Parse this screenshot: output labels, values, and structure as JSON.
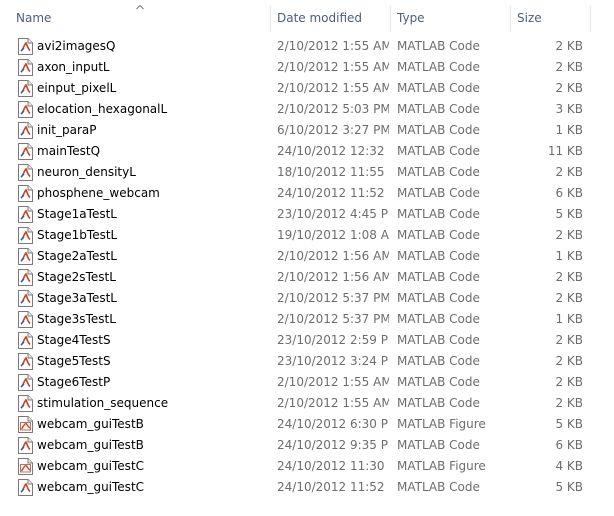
{
  "columns": {
    "name": "Name",
    "date": "Date modified",
    "type": "Type",
    "size": "Size"
  },
  "sort": {
    "column": "Name",
    "direction": "ascending",
    "icon": "sort-up-icon"
  },
  "files": [
    {
      "name": "avi2imagesQ",
      "date": "2/10/2012 1:55 AM",
      "type": "MATLAB Code",
      "size": "2 KB",
      "icon": "matlab-code-file-icon"
    },
    {
      "name": "axon_inputL",
      "date": "2/10/2012 1:55 AM",
      "type": "MATLAB Code",
      "size": "2 KB",
      "icon": "matlab-code-file-icon"
    },
    {
      "name": "einput_pixelL",
      "date": "2/10/2012 1:55 AM",
      "type": "MATLAB Code",
      "size": "2 KB",
      "icon": "matlab-code-file-icon"
    },
    {
      "name": "elocation_hexagonalL",
      "date": "2/10/2012 5:03 PM",
      "type": "MATLAB Code",
      "size": "3 KB",
      "icon": "matlab-code-file-icon"
    },
    {
      "name": "init_paraP",
      "date": "6/10/2012 3:27 PM",
      "type": "MATLAB Code",
      "size": "1 KB",
      "icon": "matlab-code-file-icon"
    },
    {
      "name": "mainTestQ",
      "date": "24/10/2012 12:32 ...",
      "type": "MATLAB Code",
      "size": "11 KB",
      "icon": "matlab-code-file-icon"
    },
    {
      "name": "neuron_densityL",
      "date": "18/10/2012 11:55 ...",
      "type": "MATLAB Code",
      "size": "2 KB",
      "icon": "matlab-code-file-icon"
    },
    {
      "name": "phosphene_webcam",
      "date": "24/10/2012 11:52 ...",
      "type": "MATLAB Code",
      "size": "6 KB",
      "icon": "matlab-code-file-icon"
    },
    {
      "name": "Stage1aTestL",
      "date": "23/10/2012 4:45 PM",
      "type": "MATLAB Code",
      "size": "5 KB",
      "icon": "matlab-code-file-icon"
    },
    {
      "name": "Stage1bTestL",
      "date": "19/10/2012 1:08 AM",
      "type": "MATLAB Code",
      "size": "2 KB",
      "icon": "matlab-code-file-icon"
    },
    {
      "name": "Stage2aTestL",
      "date": "2/10/2012 1:56 AM",
      "type": "MATLAB Code",
      "size": "1 KB",
      "icon": "matlab-code-file-icon"
    },
    {
      "name": "Stage2sTestL",
      "date": "2/10/2012 1:56 AM",
      "type": "MATLAB Code",
      "size": "2 KB",
      "icon": "matlab-code-file-icon"
    },
    {
      "name": "Stage3aTestL",
      "date": "2/10/2012 5:37 PM",
      "type": "MATLAB Code",
      "size": "2 KB",
      "icon": "matlab-code-file-icon"
    },
    {
      "name": "Stage3sTestL",
      "date": "2/10/2012 5:37 PM",
      "type": "MATLAB Code",
      "size": "1 KB",
      "icon": "matlab-code-file-icon"
    },
    {
      "name": "Stage4TestS",
      "date": "23/10/2012 2:59 PM",
      "type": "MATLAB Code",
      "size": "2 KB",
      "icon": "matlab-code-file-icon"
    },
    {
      "name": "Stage5TestS",
      "date": "23/10/2012 3:24 PM",
      "type": "MATLAB Code",
      "size": "2 KB",
      "icon": "matlab-code-file-icon"
    },
    {
      "name": "Stage6TestP",
      "date": "2/10/2012 1:55 AM",
      "type": "MATLAB Code",
      "size": "2 KB",
      "icon": "matlab-code-file-icon"
    },
    {
      "name": "stimulation_sequence",
      "date": "2/10/2012 1:55 AM",
      "type": "MATLAB Code",
      "size": "2 KB",
      "icon": "matlab-code-file-icon"
    },
    {
      "name": "webcam_guiTestB",
      "date": "24/10/2012 6:30 PM",
      "type": "MATLAB Figure",
      "size": "5 KB",
      "icon": "matlab-figure-file-icon"
    },
    {
      "name": "webcam_guiTestB",
      "date": "24/10/2012 9:35 PM",
      "type": "MATLAB Code",
      "size": "6 KB",
      "icon": "matlab-code-file-icon"
    },
    {
      "name": "webcam_guiTestC",
      "date": "24/10/2012 11:30 ...",
      "type": "MATLAB Figure",
      "size": "4 KB",
      "icon": "matlab-figure-file-icon"
    },
    {
      "name": "webcam_guiTestC",
      "date": "24/10/2012 11:52 ...",
      "type": "MATLAB Code",
      "size": "5 KB",
      "icon": "matlab-code-file-icon"
    }
  ]
}
